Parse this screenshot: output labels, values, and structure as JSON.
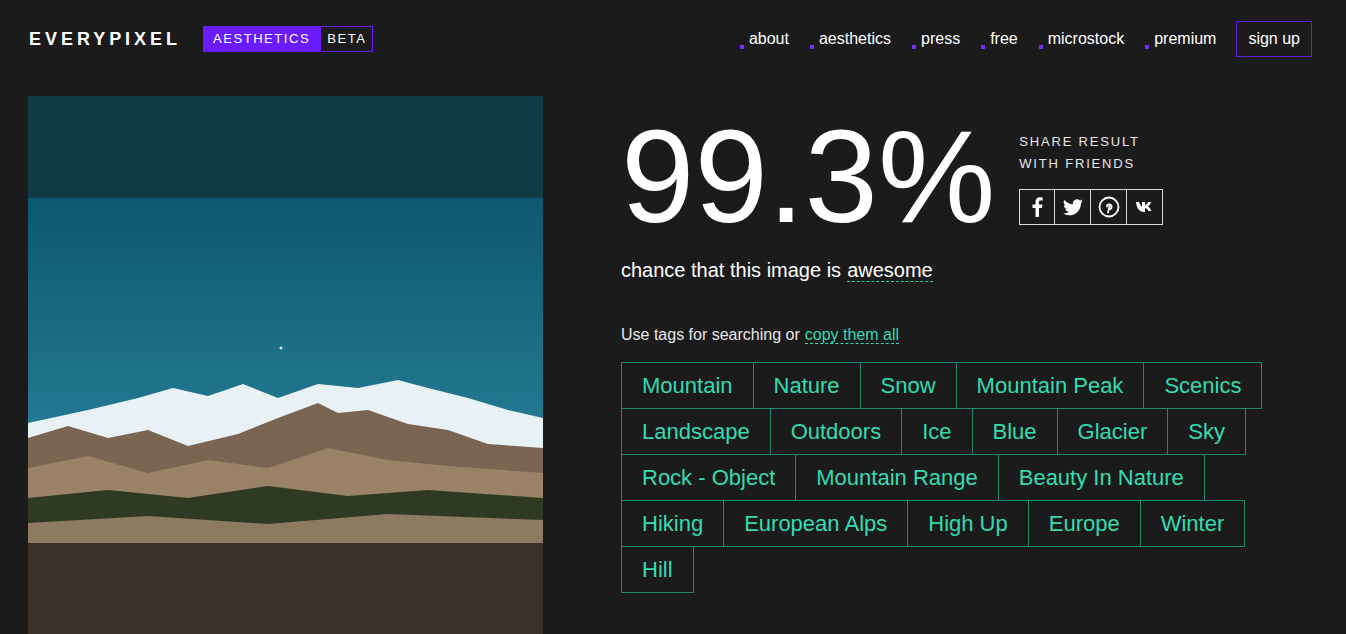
{
  "header": {
    "logo": "EVERYPIXEL",
    "badge": "AESTHETICS",
    "badge_tag": "BETA",
    "nav": [
      {
        "label": "about"
      },
      {
        "label": "aesthetics"
      },
      {
        "label": "press"
      },
      {
        "label": "free"
      },
      {
        "label": "microstock"
      },
      {
        "label": "premium"
      }
    ],
    "signup": "sign up"
  },
  "result": {
    "score": "99.3%",
    "caption": "chance that this image is",
    "verdict": "awesome"
  },
  "share": {
    "line1": "SHARE RESULT",
    "line2": "WITH FRIENDS"
  },
  "tags": {
    "intro": "Use tags for searching or",
    "copy_link": "copy them all",
    "items": [
      "Mountain",
      "Nature",
      "Snow",
      "Mountain Peak",
      "Scenics",
      "Landscape",
      "Outdoors",
      "Ice",
      "Blue",
      "Glacier",
      "Sky",
      "Rock - Object",
      "Mountain Range",
      "Beauty In Nature",
      "Hiking",
      "European Alps",
      "High Up",
      "Europe",
      "Winter",
      "Hill"
    ]
  }
}
